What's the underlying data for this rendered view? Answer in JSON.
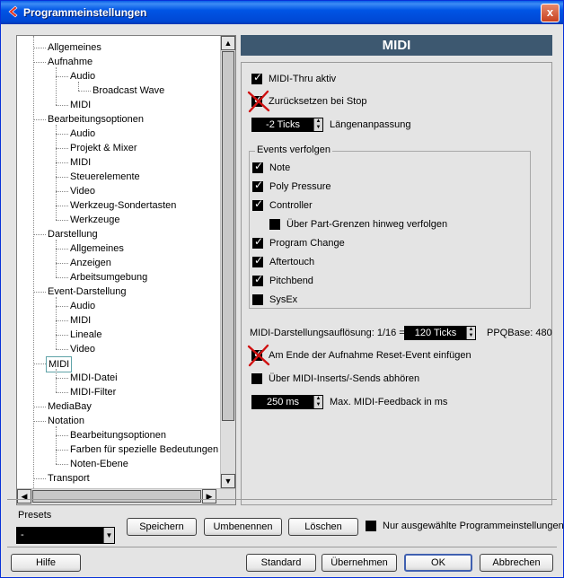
{
  "window": {
    "title": "Programmeinstellungen",
    "close_label": "x"
  },
  "tree": {
    "items": [
      {
        "label": "Allgemeines",
        "level": 1
      },
      {
        "label": "Aufnahme",
        "level": 1
      },
      {
        "label": "Audio",
        "level": 2
      },
      {
        "label": "Broadcast Wave",
        "level": 3
      },
      {
        "label": "MIDI",
        "level": 2
      },
      {
        "label": "Bearbeitungsoptionen",
        "level": 1
      },
      {
        "label": "Audio",
        "level": 2
      },
      {
        "label": "Projekt & Mixer",
        "level": 2
      },
      {
        "label": "MIDI",
        "level": 2
      },
      {
        "label": "Steuerelemente",
        "level": 2
      },
      {
        "label": "Video",
        "level": 2
      },
      {
        "label": "Werkzeug-Sondertasten",
        "level": 2
      },
      {
        "label": "Werkzeuge",
        "level": 2
      },
      {
        "label": "Darstellung",
        "level": 1
      },
      {
        "label": "Allgemeines",
        "level": 2
      },
      {
        "label": "Anzeigen",
        "level": 2
      },
      {
        "label": "Arbeitsumgebung",
        "level": 2
      },
      {
        "label": "Event-Darstellung",
        "level": 1
      },
      {
        "label": "Audio",
        "level": 2
      },
      {
        "label": "MIDI",
        "level": 2
      },
      {
        "label": "Lineale",
        "level": 2
      },
      {
        "label": "Video",
        "level": 2
      },
      {
        "label": "MIDI",
        "level": 1,
        "selected": true
      },
      {
        "label": "MIDI-Datei",
        "level": 2
      },
      {
        "label": "MIDI-Filter",
        "level": 2
      },
      {
        "label": "MediaBay",
        "level": 1
      },
      {
        "label": "Notation",
        "level": 1
      },
      {
        "label": "Bearbeitungsoptionen",
        "level": 2
      },
      {
        "label": "Farben für spezielle Bedeutungen",
        "level": 2
      },
      {
        "label": "Noten-Ebene",
        "level": 2
      },
      {
        "label": "Transport",
        "level": 1
      }
    ]
  },
  "midi": {
    "header": "MIDI",
    "midi_thru": {
      "label": "MIDI-Thru aktiv",
      "checked": true
    },
    "reset_on_stop": {
      "label": "Zurücksetzen bei Stop",
      "checked": true,
      "crossed": true
    },
    "length_adjust": {
      "value": "-2 Ticks",
      "label": "Längenanpassung"
    },
    "events_group": {
      "legend": "Events verfolgen",
      "items": [
        {
          "label": "Note",
          "checked": true
        },
        {
          "label": "Poly Pressure",
          "checked": true
        },
        {
          "label": "Controller",
          "checked": true
        },
        {
          "label": "Über Part-Grenzen hinweg verfolgen",
          "checked": false,
          "indent": true
        },
        {
          "label": "Program Change",
          "checked": true
        },
        {
          "label": "Aftertouch",
          "checked": true
        },
        {
          "label": "Pitchbend",
          "checked": true
        },
        {
          "label": "SysEx",
          "checked": false
        }
      ]
    },
    "resolution": {
      "label": "MIDI-Darstellungsauflösung: 1/16 =",
      "value": "120 Ticks",
      "ppq": "PPQBase: 480"
    },
    "reset_event": {
      "label": "Am Ende der Aufnahme Reset-Event einfügen",
      "checked": true,
      "crossed": true
    },
    "inserts_sends": {
      "label": "Über MIDI-Inserts/-Sends abhören",
      "checked": false
    },
    "feedback": {
      "value": "250 ms",
      "label": "Max. MIDI-Feedback in ms"
    }
  },
  "presets": {
    "label": "Presets",
    "selected": "-",
    "save_label": "Speichern",
    "rename_label": "Umbenennen",
    "delete_label": "Löschen",
    "only_selected_label": "Nur ausgewählte Programmeinstellungen",
    "only_selected_checked": false
  },
  "footer": {
    "help_label": "Hilfe",
    "standard_label": "Standard",
    "apply_label": "Übernehmen",
    "ok_label": "OK",
    "cancel_label": "Abbrechen"
  },
  "colors": {
    "titlebar": "#0055e5",
    "midi_header": "#3d5870",
    "selected_outline": "#5fa3a8",
    "red_x": "#d01010"
  }
}
